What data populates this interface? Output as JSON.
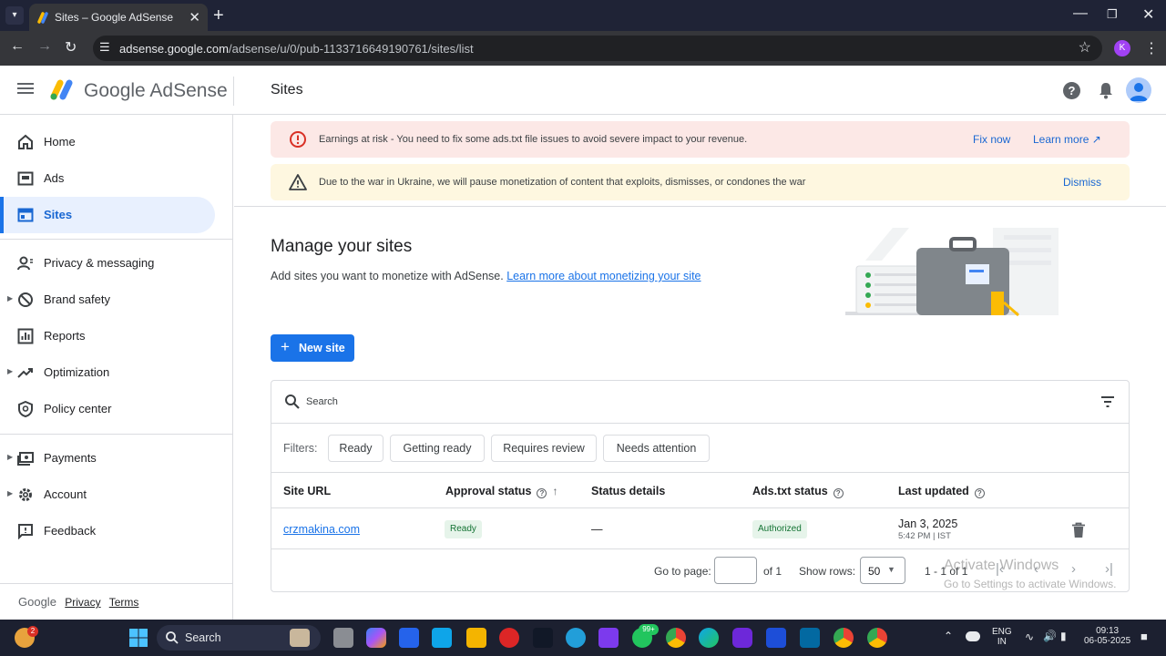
{
  "browser": {
    "tab_title": "Sites – Google AdSense",
    "url_host": "adsense.google.com",
    "url_path": "/adsense/u/0/pub-1133716649190761/sites/list",
    "profile_initial": "K"
  },
  "header": {
    "brand": "Google AdSense",
    "page_title": "Sites"
  },
  "sidebar": {
    "items": [
      {
        "label": "Home"
      },
      {
        "label": "Ads"
      },
      {
        "label": "Sites"
      },
      {
        "label": "Privacy & messaging"
      },
      {
        "label": "Brand safety"
      },
      {
        "label": "Reports"
      },
      {
        "label": "Optimization"
      },
      {
        "label": "Policy center"
      },
      {
        "label": "Payments"
      },
      {
        "label": "Account"
      },
      {
        "label": "Feedback"
      }
    ],
    "footer": {
      "google": "Google",
      "privacy": "Privacy",
      "terms": "Terms"
    }
  },
  "banners": {
    "risk": {
      "text": "Earnings at risk - You need to fix some ads.txt file issues to avoid severe impact to your revenue.",
      "fix": "Fix now",
      "learn": "Learn more"
    },
    "war": {
      "text": "Due to the war in Ukraine, we will pause monetization of content that exploits, dismisses, or condones the war",
      "dismiss": "Dismiss"
    }
  },
  "main": {
    "title": "Manage your sites",
    "desc": "Add sites you want to monetize with AdSense.",
    "desc_link": "Learn more about monetizing your site",
    "new_site": "New site"
  },
  "table": {
    "search_placeholder": "Search",
    "filters_label": "Filters:",
    "filters": [
      "Ready",
      "Getting ready",
      "Requires review",
      "Needs attention"
    ],
    "headers": {
      "site": "Site URL",
      "approval": "Approval status",
      "details": "Status details",
      "adstxt": "Ads.txt status",
      "updated": "Last updated"
    },
    "rows": [
      {
        "site": "crzmakina.com",
        "approval": "Ready",
        "details": "—",
        "adstxt": "Authorized",
        "date": "Jan 3, 2025",
        "time": "5:42 PM | IST"
      }
    ],
    "pagination": {
      "goto_label": "Go to page:",
      "of_pages": "of 1",
      "rows_label": "Show rows:",
      "rows_value": "50",
      "range": "1 - 1 of 1"
    }
  },
  "watermark": {
    "line1": "Activate Windows",
    "line2": "Go to Settings to activate Windows."
  },
  "taskbar": {
    "search": "Search",
    "whatsapp_badge": "99+",
    "lang": "ENG",
    "region": "IN",
    "time": "09:13",
    "date": "06-05-2025",
    "weather_badge": "2"
  },
  "colors": {
    "accent": "#1a73e8",
    "error": "#d93025",
    "warning_bg": "#fef7e0",
    "error_bg": "#fce8e6",
    "ready_bg": "#e6f4ea"
  }
}
